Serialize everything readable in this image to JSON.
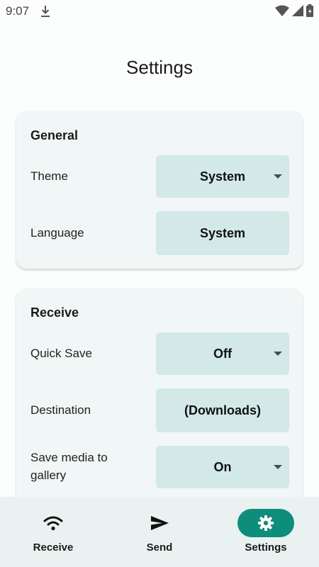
{
  "status_bar": {
    "time": "9:07"
  },
  "page": {
    "title": "Settings"
  },
  "general": {
    "title": "General",
    "theme": {
      "label": "Theme",
      "value": "System"
    },
    "language": {
      "label": "Language",
      "value": "System"
    }
  },
  "receive": {
    "title": "Receive",
    "quick_save": {
      "label": "Quick Save",
      "value": "Off"
    },
    "destination": {
      "label": "Destination",
      "value": "(Downloads)"
    },
    "save_media": {
      "label": "Save media to gallery",
      "value": "On"
    }
  },
  "bottom_nav": {
    "items": [
      {
        "label": "Receive",
        "icon": "wifi-icon"
      },
      {
        "label": "Send",
        "icon": "send-icon"
      },
      {
        "label": "Settings",
        "icon": "gear-icon",
        "active": true
      }
    ]
  },
  "colors": {
    "accent": "#0e8d7c",
    "field_bg": "#d2e9e8",
    "card_bg": "#f1f7f6"
  }
}
